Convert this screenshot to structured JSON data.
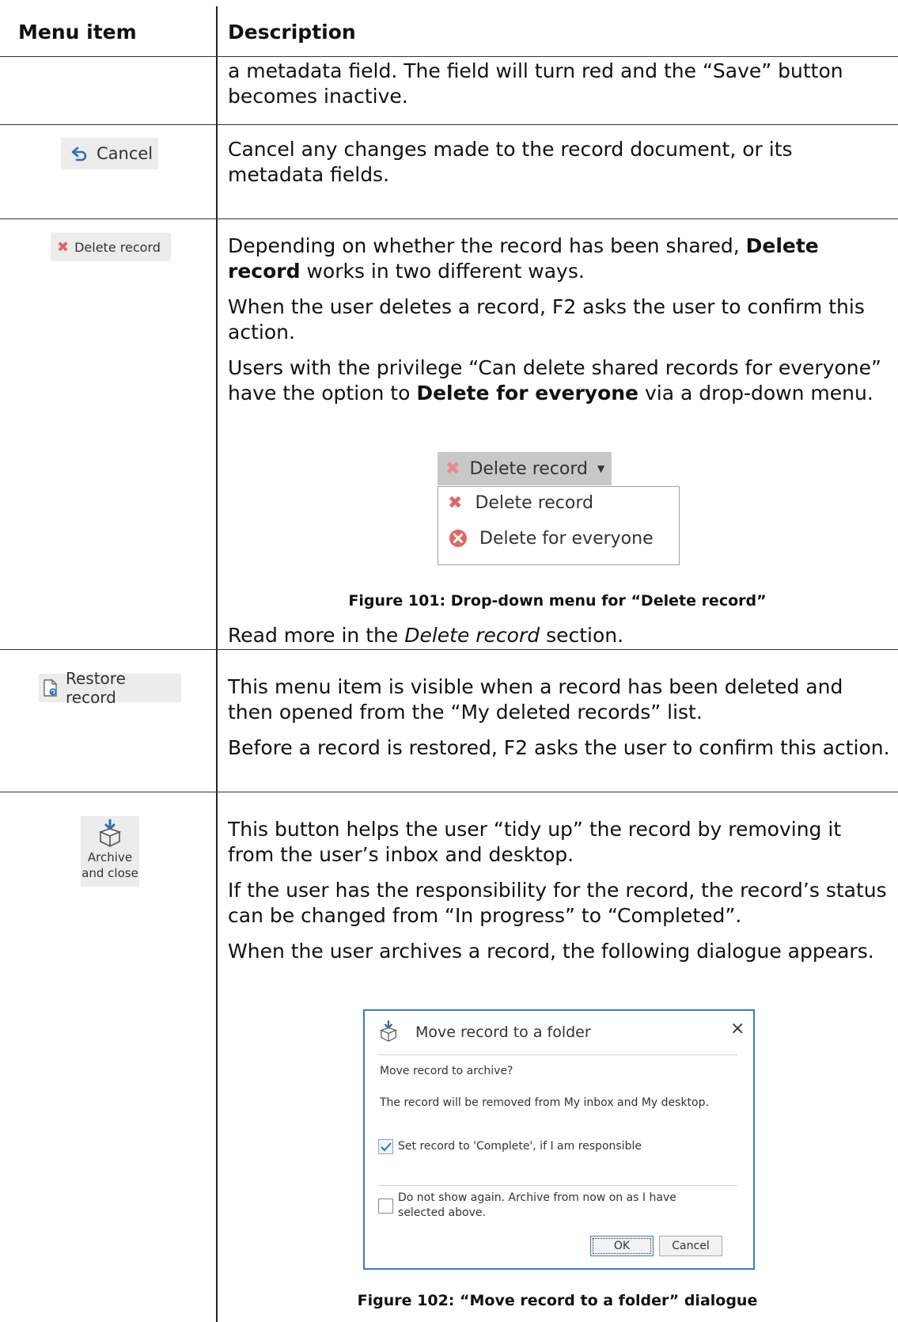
{
  "table": {
    "headers": {
      "menu_item": "Menu item",
      "description": "Description"
    }
  },
  "rows": {
    "save_tail": {
      "text": "a metadata field. The field will turn red and the “Save” button becomes inactive."
    },
    "cancel": {
      "icon_label": "Cancel",
      "text": "Cancel any changes made to the record document, or its metadata fields."
    },
    "delete": {
      "icon_label": "Delete record",
      "p1_pre": "Depending on whether the record has been shared, ",
      "p1_bold": "Delete record",
      "p1_post": " works in two different ways.",
      "p2": "When the user deletes a record, F2 asks the user to confirm this action.",
      "p3_pre": "Users with the privilege “Can delete shared records for everyone” have the option to ",
      "p3_bold": "Delete for everyone",
      "p3_post": " via a drop-down menu.",
      "dropdown": {
        "button_label": "Delete record",
        "items": [
          "Delete record",
          "Delete for everyone"
        ]
      },
      "caption": "Figure 101: Drop-down menu for “Delete record”",
      "p4_pre": "Read more in the ",
      "p4_italic": "Delete record",
      "p4_post": " section."
    },
    "restore": {
      "icon_label": "Restore record",
      "p1": "This menu item is visible when a record has been deleted and then opened from the “My deleted records” list.",
      "p2": "Before a record is restored, F2 asks the user to confirm this action."
    },
    "archive": {
      "icon_label_line1": "Archive",
      "icon_label_line2": "and close",
      "p1": "This button helps the user “tidy up” the record by removing it from the user’s inbox and desktop.",
      "p2": "If the user has the responsibility for the record, the record’s status can be changed from “In progress” to “Completed”.",
      "p3": "When the user archives a record, the following dialogue appears.",
      "dialog": {
        "title": "Move record to a folder",
        "close": "×",
        "question": "Move record to archive?",
        "info": "The record will be removed from My inbox and My desktop.",
        "checkbox1_label": "Set record to 'Complete', if I am responsible",
        "checkbox1_checked": true,
        "checkbox2_label": "Do not show again. Archive from now on as I have selected above.",
        "checkbox2_checked": false,
        "ok": "OK",
        "cancel": "Cancel"
      },
      "caption": "Figure 102: “Move record to a folder” dialogue"
    }
  },
  "colors": {
    "dialog_border": "#3a7cc8",
    "delete_red": "#e06666",
    "cancel_blue": "#2f6fb5"
  }
}
